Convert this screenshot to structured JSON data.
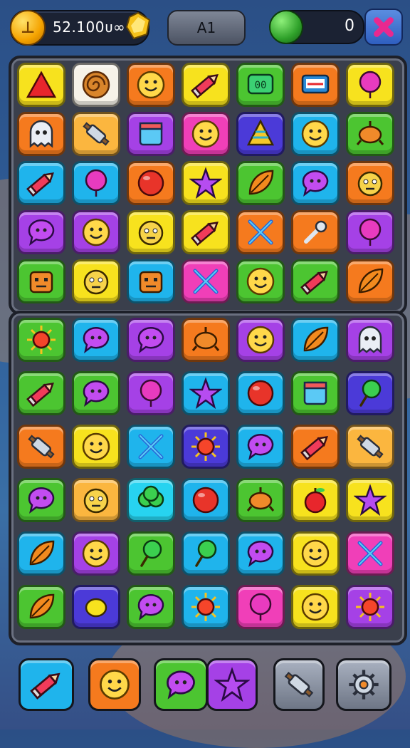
{
  "hud": {
    "coins": "52.100ᴜ∞",
    "level": "A1",
    "score": "0",
    "icons": {
      "coin": "coin-icon",
      "gem": "gem-icon",
      "orb": "green-orb-icon",
      "close": "close-x-icon"
    }
  },
  "palette": {
    "red": "#e8343a",
    "orange": "#f57a1e",
    "yellow": "#f7e21e",
    "green": "#4cc531",
    "blue": "#1fb4ec",
    "purple": "#a541e6",
    "pink": "#f03fb8",
    "white": "#f6f2e8",
    "lightorange": "#fbb63f",
    "indigo": "#4b3ad8",
    "lime": "#9be23a",
    "cyan": "#27d3f0"
  },
  "board_top": {
    "rows": [
      [
        {
          "c": "yellow",
          "i": "red-triangle"
        },
        {
          "c": "white",
          "i": "spiral"
        },
        {
          "c": "orange",
          "i": "smiley"
        },
        {
          "c": "yellow",
          "i": "pencil"
        },
        {
          "c": "green",
          "i": "monitor"
        },
        {
          "c": "orange",
          "i": "sign"
        },
        {
          "c": "yellow",
          "i": "balloon"
        }
      ],
      [
        {
          "c": "orange",
          "i": "ghost"
        },
        {
          "c": "lightorange",
          "i": "rolling-pin"
        },
        {
          "c": "purple",
          "i": "window"
        },
        {
          "c": "pink",
          "i": "smiley"
        },
        {
          "c": "indigo",
          "i": "cone"
        },
        {
          "c": "blue",
          "i": "smiley"
        },
        {
          "c": "green",
          "i": "turtle"
        }
      ],
      [
        {
          "c": "blue",
          "i": "pencil"
        },
        {
          "c": "blue",
          "i": "balloon"
        },
        {
          "c": "orange",
          "i": "ball"
        },
        {
          "c": "yellow",
          "i": "star"
        },
        {
          "c": "green",
          "i": "leaf"
        },
        {
          "c": "blue",
          "i": "chat"
        },
        {
          "c": "orange",
          "i": "face"
        }
      ],
      [
        {
          "c": "purple",
          "i": "chat"
        },
        {
          "c": "purple",
          "i": "smiley"
        },
        {
          "c": "yellow",
          "i": "face"
        },
        {
          "c": "yellow",
          "i": "pencil"
        },
        {
          "c": "orange",
          "i": "arrows"
        },
        {
          "c": "orange",
          "i": "wrench"
        },
        {
          "c": "purple",
          "i": "balloon"
        }
      ],
      [
        {
          "c": "green",
          "i": "robot"
        },
        {
          "c": "yellow",
          "i": "face"
        },
        {
          "c": "blue",
          "i": "robot"
        },
        {
          "c": "pink",
          "i": "arrows"
        },
        {
          "c": "green",
          "i": "smiley"
        },
        {
          "c": "green",
          "i": "pencil"
        },
        {
          "c": "orange",
          "i": "leaf"
        }
      ]
    ]
  },
  "board_bottom": {
    "rows": [
      [
        {
          "c": "green",
          "i": "sun"
        },
        {
          "c": "blue",
          "i": "chat"
        },
        {
          "c": "purple",
          "i": "chat"
        },
        {
          "c": "orange",
          "i": "turtle"
        },
        {
          "c": "purple",
          "i": "smiley"
        },
        {
          "c": "blue",
          "i": "leaf"
        },
        {
          "c": "purple",
          "i": "ghost"
        }
      ],
      [
        {
          "c": "green",
          "i": "pencil"
        },
        {
          "c": "green",
          "i": "chat"
        },
        {
          "c": "purple",
          "i": "balloon"
        },
        {
          "c": "blue",
          "i": "star"
        },
        {
          "c": "blue",
          "i": "ball"
        },
        {
          "c": "green",
          "i": "window"
        },
        {
          "c": "indigo",
          "i": "lollipop"
        }
      ],
      [
        {
          "c": "orange",
          "i": "rolling-pin"
        },
        {
          "c": "yellow",
          "i": "smiley"
        },
        {
          "c": "blue",
          "i": "arrows"
        },
        {
          "c": "indigo",
          "i": "sun"
        },
        {
          "c": "blue",
          "i": "chat"
        },
        {
          "c": "orange",
          "i": "pencil"
        },
        {
          "c": "lightorange",
          "i": "rolling-pin"
        }
      ],
      [
        {
          "c": "green",
          "i": "chat"
        },
        {
          "c": "lightorange",
          "i": "face"
        },
        {
          "c": "cyan",
          "i": "bush"
        },
        {
          "c": "blue",
          "i": "ball"
        },
        {
          "c": "green",
          "i": "turtle"
        },
        {
          "c": "yellow",
          "i": "apple"
        },
        {
          "c": "yellow",
          "i": "star"
        }
      ],
      [
        {
          "c": "blue",
          "i": "leaf"
        },
        {
          "c": "purple",
          "i": "smiley"
        },
        {
          "c": "green",
          "i": "lollipop"
        },
        {
          "c": "blue",
          "i": "lollipop"
        },
        {
          "c": "blue",
          "i": "chat"
        },
        {
          "c": "yellow",
          "i": "smiley"
        },
        {
          "c": "pink",
          "i": "arrows"
        }
      ],
      [
        {
          "c": "green",
          "i": "leaf"
        },
        {
          "c": "indigo",
          "i": "lemon"
        },
        {
          "c": "green",
          "i": "chat"
        },
        {
          "c": "blue",
          "i": "sun"
        },
        {
          "c": "pink",
          "i": "balloon"
        },
        {
          "c": "yellow",
          "i": "smiley"
        },
        {
          "c": "purple",
          "i": "sun"
        }
      ]
    ]
  },
  "powerups": [
    {
      "name": "pencil-powerup",
      "c": "blue",
      "i": "pencil"
    },
    {
      "name": "smiley-powerup",
      "c": "orange",
      "i": "smiley"
    },
    {
      "name": "chat-powerup",
      "c": "green",
      "i": "chat"
    },
    {
      "name": "star-powerup",
      "c": "purple",
      "i": "star"
    },
    {
      "name": "rolling-pin-powerup",
      "c": "white",
      "i": "rolling-pin"
    },
    {
      "name": "gear-powerup",
      "c": "white",
      "i": "gear"
    }
  ]
}
